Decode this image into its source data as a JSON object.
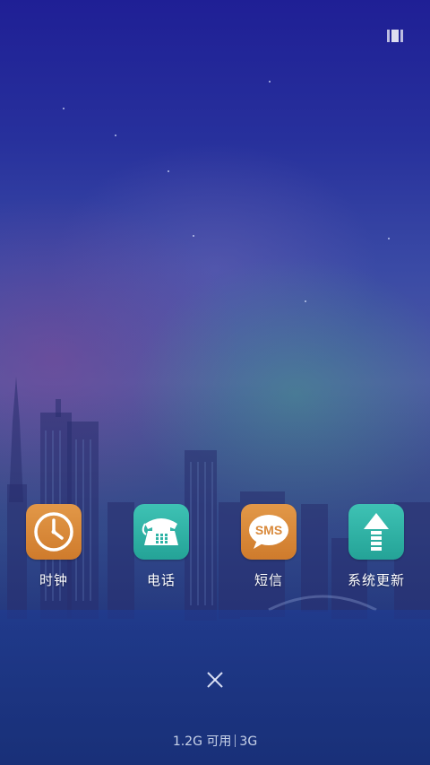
{
  "dock": {
    "apps": [
      {
        "label": "时钟",
        "icon": "clock-icon",
        "color": "#d9893a"
      },
      {
        "label": "电话",
        "icon": "telephone-icon",
        "color": "#2fb3a6"
      },
      {
        "label": "短信",
        "icon": "sms-icon",
        "color": "#d9893a",
        "badge_text": "SMS"
      },
      {
        "label": "系统更新",
        "icon": "update-arrow-icon",
        "color": "#2fb3a6"
      }
    ]
  },
  "top_right_icon": "recents-layout-icon",
  "close_icon": "close-icon",
  "status": {
    "memory": "1.2G 可用",
    "network": "3G"
  }
}
